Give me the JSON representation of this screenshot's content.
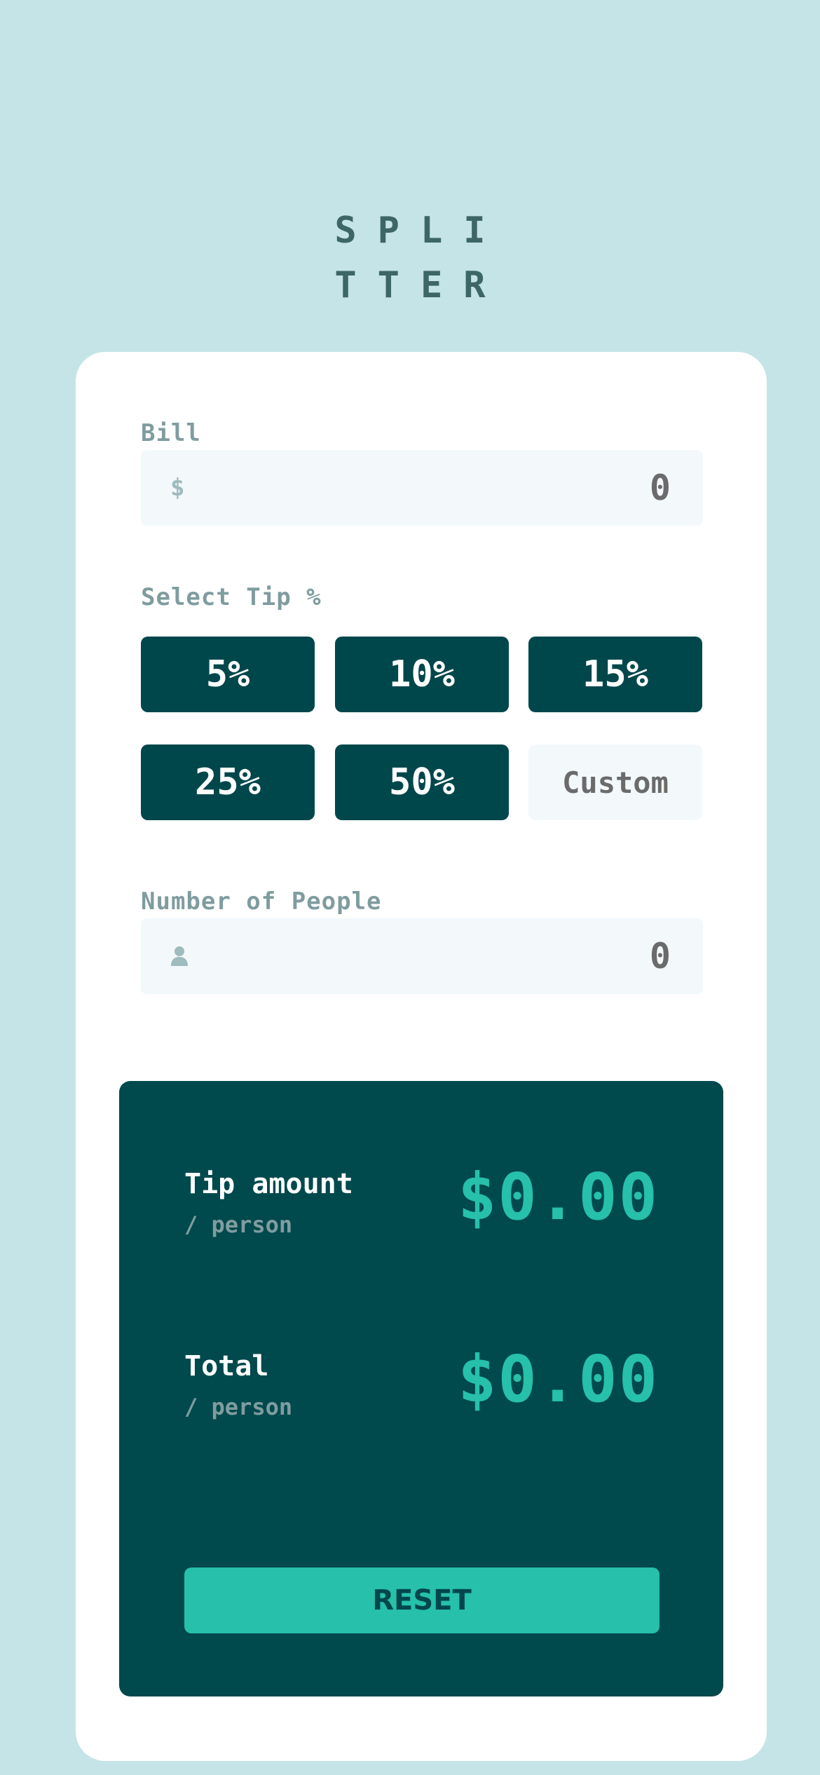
{
  "app": {
    "logo_line1": "SPLI",
    "logo_line2": "TTER"
  },
  "bill": {
    "label": "Bill",
    "currency_icon": "dollar-icon",
    "currency_symbol": "$",
    "value": "0"
  },
  "tip": {
    "label": "Select Tip %",
    "options": [
      "5%",
      "10%",
      "15%",
      "25%",
      "50%"
    ],
    "custom_placeholder": "Custom"
  },
  "people": {
    "label": "Number of People",
    "icon": "person-icon",
    "value": "0"
  },
  "results": {
    "tip_amount_title": "Tip amount",
    "tip_amount_sub": "/ person",
    "tip_amount_value": "$0.00",
    "total_title": "Total",
    "total_sub": "/ person",
    "total_value": "$0.00",
    "reset_label": "RESET"
  },
  "colors": {
    "background": "#c5e4e7",
    "dark_cyan": "#00474b",
    "accent": "#26c0ab",
    "input_bg": "#f3f8fb"
  }
}
